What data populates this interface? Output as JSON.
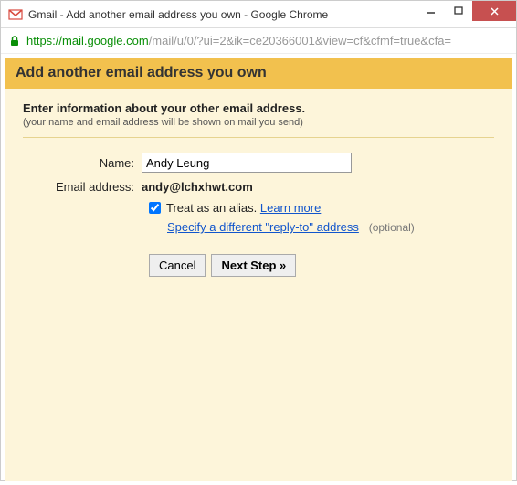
{
  "window": {
    "title": "Gmail - Add another email address you own - Google Chrome"
  },
  "url": {
    "secure_part": "https://mail.google.com",
    "rest_part": "/mail/u/0/?ui=2&ik=ce20366001&view=cf&cfmf=true&cfa="
  },
  "header": {
    "title": "Add another email address you own"
  },
  "intro": {
    "title": "Enter information about your other email address.",
    "subtitle": "(your name and email address will be shown on mail you send)"
  },
  "form": {
    "name_label": "Name:",
    "name_value": "Andy Leung",
    "email_label": "Email address:",
    "email_value": "andy@lchxhwt.com",
    "alias_text": "Treat as an alias.",
    "learn_more": "Learn more",
    "replyto_link": "Specify a different \"reply-to\" address",
    "optional": "(optional)"
  },
  "buttons": {
    "cancel": "Cancel",
    "next": "Next Step »"
  }
}
